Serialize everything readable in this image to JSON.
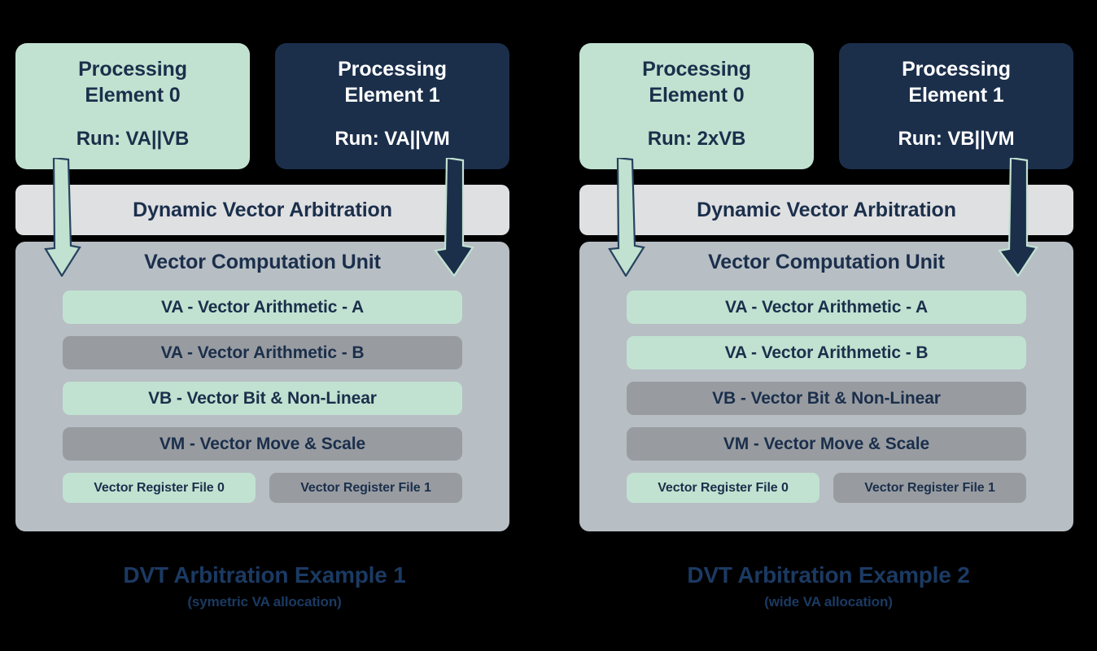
{
  "diagram": {
    "panels": [
      {
        "id": "example-1",
        "processing_elements": [
          {
            "title_line1": "Processing",
            "title_line2": "Element 0",
            "run": "Run: VA||VB",
            "theme": "green"
          },
          {
            "title_line1": "Processing",
            "title_line2": "Element 1",
            "run": "Run: VA||VM",
            "theme": "navy"
          }
        ],
        "arbitration_label": "Dynamic Vector Arbitration",
        "vcu_title": "Vector Computation Unit",
        "units": [
          {
            "label": "VA - Vector Arithmetic - A",
            "color": "green"
          },
          {
            "label": "VA - Vector Arithmetic - B",
            "color": "gray"
          },
          {
            "label": "VB - Vector Bit & Non-Linear",
            "color": "green"
          },
          {
            "label": "VM - Vector Move & Scale",
            "color": "gray"
          }
        ],
        "register_files": [
          {
            "label": "Vector Register File 0",
            "color": "green"
          },
          {
            "label": "Vector Register File 1",
            "color": "gray"
          }
        ],
        "caption_title": "DVT Arbitration Example 1",
        "caption_subtitle": "(symetric VA allocation)"
      },
      {
        "id": "example-2",
        "processing_elements": [
          {
            "title_line1": "Processing",
            "title_line2": "Element 0",
            "run": "Run: 2xVB",
            "theme": "green"
          },
          {
            "title_line1": "Processing",
            "title_line2": "Element 1",
            "run": "Run: VB||VM",
            "theme": "navy"
          }
        ],
        "arbitration_label": "Dynamic Vector Arbitration",
        "vcu_title": "Vector Computation Unit",
        "units": [
          {
            "label": "VA - Vector Arithmetic - A",
            "color": "green"
          },
          {
            "label": "VA - Vector Arithmetic - B",
            "color": "green"
          },
          {
            "label": "VB - Vector Bit & Non-Linear",
            "color": "gray"
          },
          {
            "label": "VM - Vector Move & Scale",
            "color": "gray"
          }
        ],
        "register_files": [
          {
            "label": "Vector Register File 0",
            "color": "green"
          },
          {
            "label": "Vector Register File 1",
            "color": "gray"
          }
        ],
        "caption_title": "DVT Arbitration Example 2",
        "caption_subtitle": "(wide VA allocation)"
      }
    ],
    "colors": {
      "background": "#000000",
      "green": "#c2e2d1",
      "navy": "#1b2f4b",
      "gray_unit": "#989ca1",
      "vcu_container": "#b7bec4",
      "arbitration_bar": "#dfe0e2",
      "caption_text": "#1b3a63"
    },
    "icons": {
      "left_arrow": "down-arrow-green-icon",
      "right_arrow": "down-arrow-navy-icon"
    }
  }
}
